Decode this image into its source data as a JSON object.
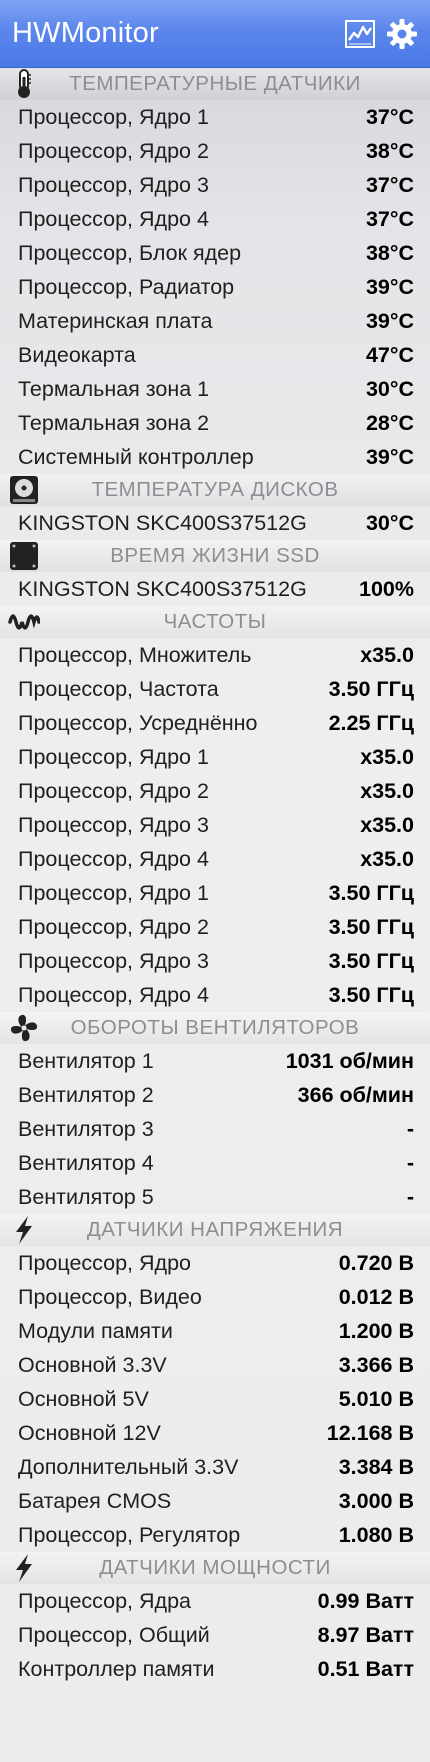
{
  "app": {
    "title": "HWMonitor",
    "icons": [
      "chart-icon",
      "gear-icon"
    ]
  },
  "sections": [
    {
      "id": "temps",
      "icon": "thermometer-icon",
      "title": "ТЕМПЕРАТУРНЫЕ ДАТЧИКИ",
      "rows": [
        {
          "label": "Процессор, Ядро 1",
          "value": "37°C"
        },
        {
          "label": "Процессор, Ядро 2",
          "value": "38°C"
        },
        {
          "label": "Процессор, Ядро 3",
          "value": "37°C"
        },
        {
          "label": "Процессор, Ядро 4",
          "value": "37°C"
        },
        {
          "label": "Процессор, Блок ядер",
          "value": "38°C"
        },
        {
          "label": "Процессор, Радиатор",
          "value": "39°C"
        },
        {
          "label": "Материнская плата",
          "value": "39°C"
        },
        {
          "label": "Видеокарта",
          "value": "47°C"
        },
        {
          "label": "Термальная зона 1",
          "value": "30°C"
        },
        {
          "label": "Термальная зона 2",
          "value": "28°C"
        },
        {
          "label": "Системный контроллер",
          "value": "39°C"
        }
      ]
    },
    {
      "id": "disk-temps",
      "icon": "hard-disk-icon",
      "title": "ТЕМПЕРАТУРА ДИСКОВ",
      "rows": [
        {
          "label": "KINGSTON SKC400S37512G",
          "value": "30°C"
        }
      ]
    },
    {
      "id": "ssd-life",
      "icon": "ssd-icon",
      "title": "ВРЕМЯ ЖИЗНИ SSD",
      "rows": [
        {
          "label": "KINGSTON SKC400S37512G",
          "value": "100%"
        }
      ]
    },
    {
      "id": "freqs",
      "icon": "frequency-wave-icon",
      "title": "ЧАСТОТЫ",
      "rows": [
        {
          "label": "Процессор, Множитель",
          "value": "x35.0"
        },
        {
          "label": "Процессор, Частота",
          "value": "3.50 ГГц"
        },
        {
          "label": "Процессор, Усреднённо",
          "value": "2.25 ГГц"
        },
        {
          "label": "Процессор, Ядро 1",
          "value": "x35.0"
        },
        {
          "label": "Процессор, Ядро 2",
          "value": "x35.0"
        },
        {
          "label": "Процессор, Ядро 3",
          "value": "x35.0"
        },
        {
          "label": "Процессор, Ядро 4",
          "value": "x35.0"
        },
        {
          "label": "Процессор, Ядро 1",
          "value": "3.50 ГГц"
        },
        {
          "label": "Процессор, Ядро 2",
          "value": "3.50 ГГц"
        },
        {
          "label": "Процессор, Ядро 3",
          "value": "3.50 ГГц"
        },
        {
          "label": "Процессор, Ядро 4",
          "value": "3.50 ГГц"
        }
      ]
    },
    {
      "id": "fans",
      "icon": "fan-icon",
      "title": "ОБОРОТЫ ВЕНТИЛЯТОРОВ",
      "rows": [
        {
          "label": "Вентилятор 1",
          "value": "1031 об/мин"
        },
        {
          "label": "Вентилятор 2",
          "value": "366 об/мин"
        },
        {
          "label": "Вентилятор 3",
          "value": "-"
        },
        {
          "label": "Вентилятор 4",
          "value": "-"
        },
        {
          "label": "Вентилятор 5",
          "value": "-"
        }
      ]
    },
    {
      "id": "voltages",
      "icon": "lightning-icon",
      "title": "ДАТЧИКИ НАПРЯЖЕНИЯ",
      "rows": [
        {
          "label": "Процессор, Ядро",
          "value": "0.720 В"
        },
        {
          "label": "Процессор, Видео",
          "value": "0.012 В"
        },
        {
          "label": "Модули памяти",
          "value": "1.200 В"
        },
        {
          "label": "Основной 3.3V",
          "value": "3.366 В"
        },
        {
          "label": "Основной 5V",
          "value": "5.010 В"
        },
        {
          "label": "Основной 12V",
          "value": "12.168 В"
        },
        {
          "label": "Дополнительный 3.3V",
          "value": "3.384 В"
        },
        {
          "label": "Батарея CMOS",
          "value": "3.000 В"
        },
        {
          "label": "Процессор, Регулятор",
          "value": "1.080 В"
        }
      ]
    },
    {
      "id": "power",
      "icon": "lightning-icon",
      "title": "ДАТЧИКИ МОЩНОСТИ",
      "rows": [
        {
          "label": "Процессор, Ядра",
          "value": "0.99 Ватт"
        },
        {
          "label": "Процессор, Общий",
          "value": "8.97 Ватт"
        },
        {
          "label": "Контроллер памяти",
          "value": "0.51 Ватт"
        }
      ]
    }
  ]
}
